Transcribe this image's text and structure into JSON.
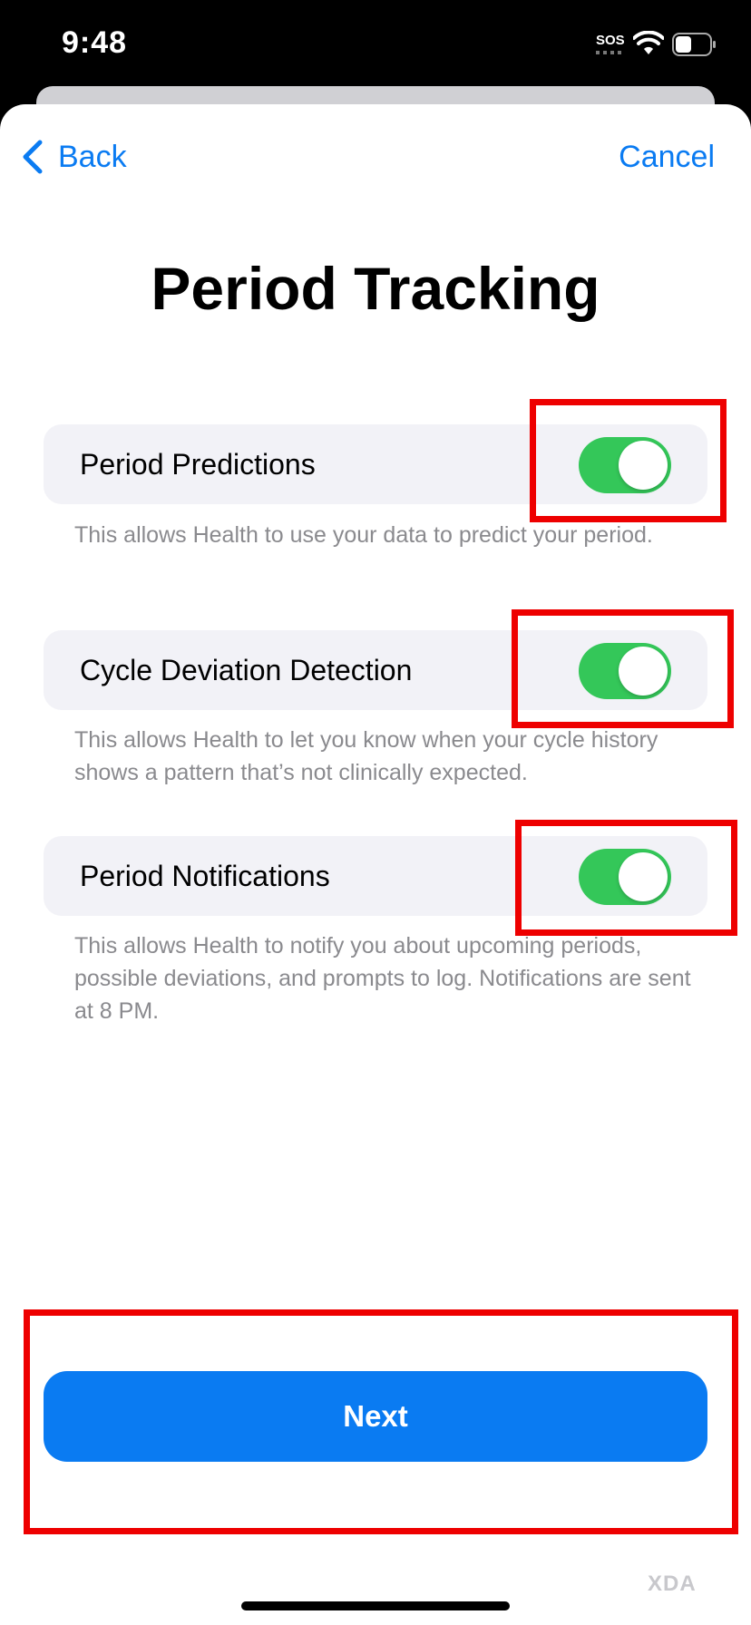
{
  "status_bar": {
    "time": "9:48",
    "carrier": "SOS",
    "wifi_icon": "wifi-icon",
    "battery_icon": "battery-icon"
  },
  "nav": {
    "back_label": "Back",
    "back_icon": "chevron-left-icon",
    "cancel_label": "Cancel"
  },
  "title": "Period Tracking",
  "settings": [
    {
      "label": "Period Predictions",
      "enabled": true,
      "description": "This allows Health to use your data to predict your period."
    },
    {
      "label": "Cycle Deviation Detection",
      "enabled": true,
      "description": "This allows Health to let you know when your cycle history shows a pattern that’s not clinically expected."
    },
    {
      "label": "Period Notifications",
      "enabled": true,
      "description": "This allows Health to notify you about upcoming periods, possible deviations, and prompts to log. Notifications are sent at 8 PM."
    }
  ],
  "next_button_label": "Next",
  "watermark": "XDA",
  "colors": {
    "accent": "#0a7bf2",
    "toggle_on": "#34c759",
    "highlight": "#ee0000",
    "row_background": "#f2f2f7"
  }
}
